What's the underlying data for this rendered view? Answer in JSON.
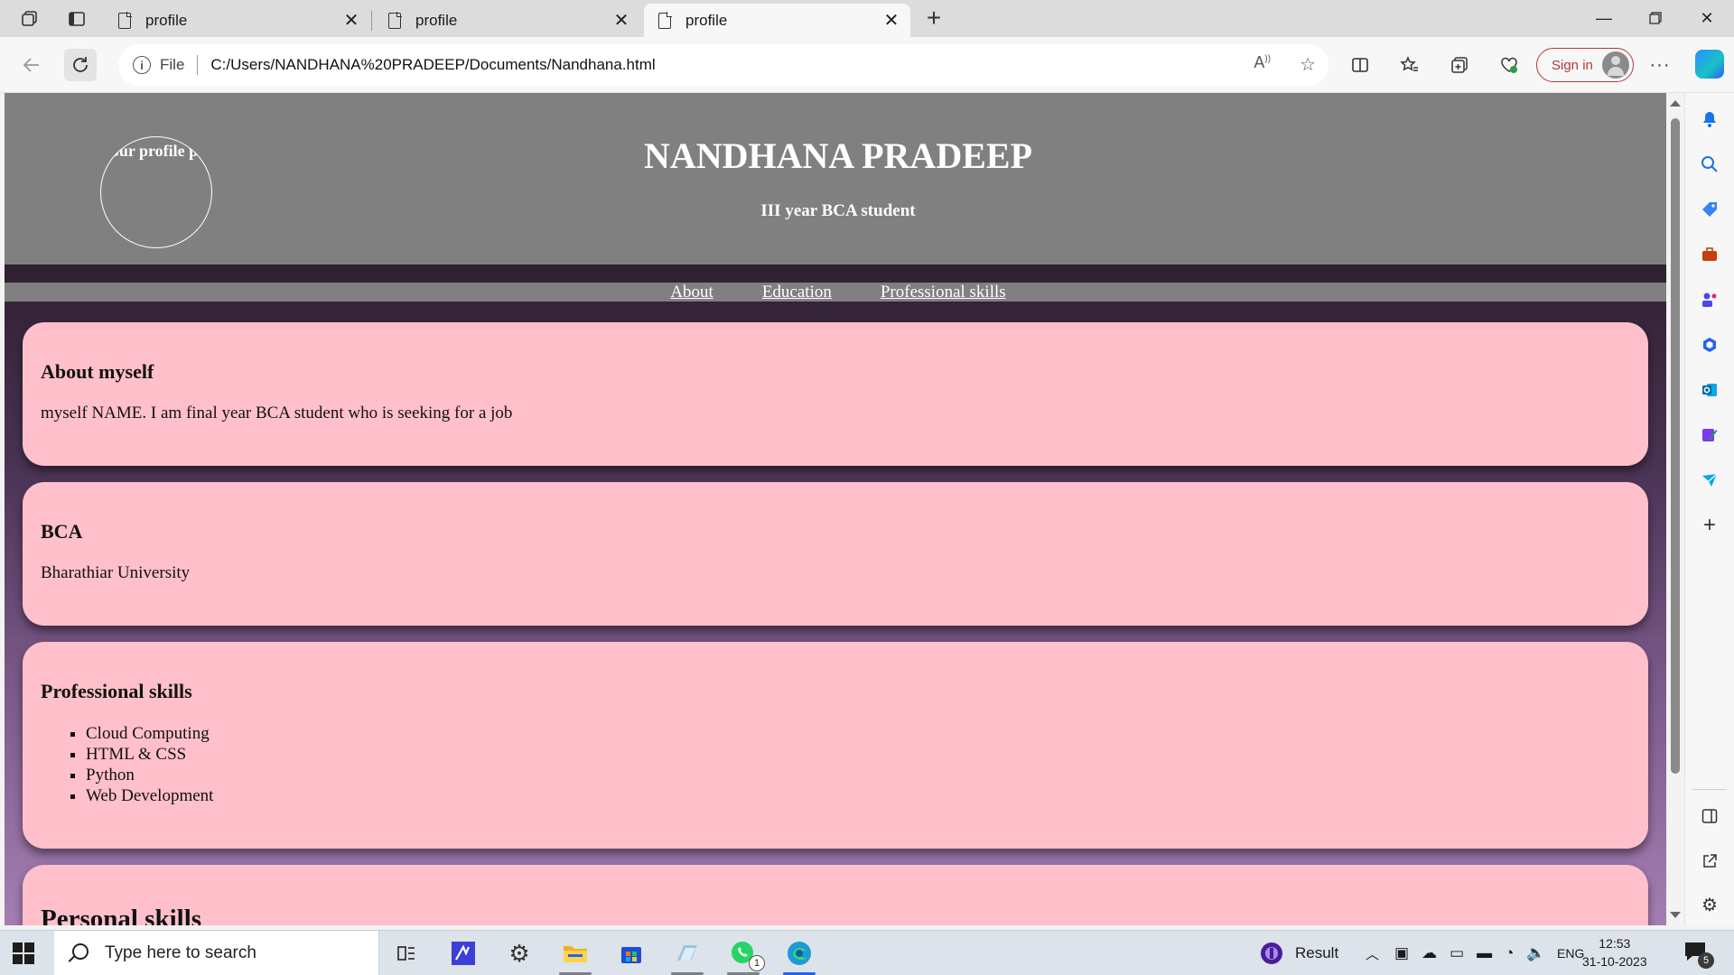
{
  "browser": {
    "tabs": [
      {
        "title": "profile",
        "active": false
      },
      {
        "title": "profile",
        "active": false
      },
      {
        "title": "profile",
        "active": true
      }
    ],
    "address": {
      "scheme_label": "File",
      "url": "C:/Users/NANDHANA%20PRADEEP/Documents/Nandhana.html"
    },
    "signin_label": "Sign in",
    "icons": {
      "workspaces": "workspaces-icon",
      "tab_actions": "tab-actions-icon",
      "back": "back-arrow-icon",
      "refresh": "refresh-icon",
      "read_aloud": "read-aloud-icon",
      "favorite": "star-icon",
      "split": "split-screen-icon",
      "favorites": "favorites-icon",
      "collections": "collections-icon",
      "performance": "heart-pulse-icon",
      "more": "more-icon",
      "copilot": "copilot-icon"
    }
  },
  "page": {
    "profile_pic_alt": "your profile pic",
    "name": "NANDHANA PRADEEP",
    "role": "III year BCA student",
    "nav": [
      "About",
      "Education",
      "Professional skills"
    ],
    "sections": {
      "about": {
        "heading": "About myself",
        "text": "myself NAME. I am final year BCA student who is seeking for a job"
      },
      "education": {
        "heading": "BCA",
        "text": "Bharathiar University"
      },
      "skills": {
        "heading": "Professional skills",
        "items": [
          "Cloud Computing",
          "HTML & CSS",
          "Python",
          "Web Development"
        ]
      },
      "personal": {
        "heading": "Personal skills"
      }
    },
    "colors": {
      "header_gray": "#808080",
      "card_pink": "#ffc0cb"
    }
  },
  "taskbar": {
    "search_placeholder": "Type here to search",
    "weather_label": "Result",
    "language": "ENG",
    "time": "12:53",
    "date": "31-10-2023",
    "whatsapp_badge": "1",
    "notification_badge": "5"
  }
}
